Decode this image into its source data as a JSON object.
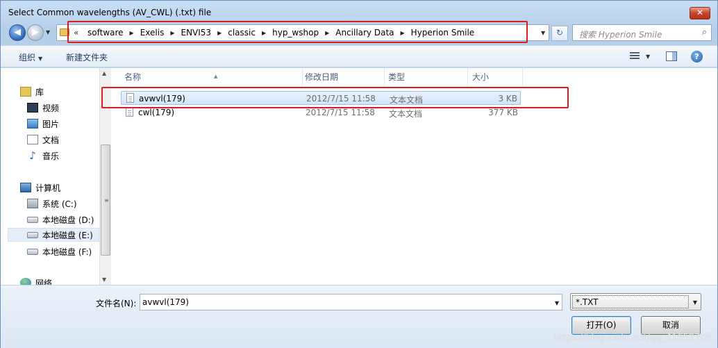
{
  "window": {
    "title": "Select Common wavelengths (AV_CWL) (.txt) file",
    "close_glyph": "✕"
  },
  "nav": {
    "back_glyph": "◀",
    "forward_glyph": "▶",
    "address": {
      "overflow_glyph": "«",
      "crumbs": [
        "software",
        "Exelis",
        "ENVI53",
        "classic",
        "hyp_wshop",
        "Ancillary Data",
        "Hyperion Smile"
      ],
      "separator_glyph": "▶"
    },
    "refresh_glyph": "↻",
    "search_placeholder": "搜索 Hyperion Smile"
  },
  "toolbar": {
    "organize": "组织",
    "new_folder": "新建文件夹"
  },
  "sidebar": {
    "items": [
      {
        "label": "库",
        "icon": "library-icon"
      },
      {
        "label": "视频",
        "icon": "video-icon"
      },
      {
        "label": "图片",
        "icon": "pictures-icon"
      },
      {
        "label": "文档",
        "icon": "documents-icon"
      },
      {
        "label": "音乐",
        "icon": "music-icon"
      },
      {
        "label": "计算机",
        "icon": "computer-icon"
      },
      {
        "label": "系统 (C:)",
        "icon": "system-drive-icon"
      },
      {
        "label": "本地磁盘 (D:)",
        "icon": "drive-icon"
      },
      {
        "label": "本地磁盘 (E:)",
        "icon": "drive-icon",
        "selected": true
      },
      {
        "label": "本地磁盘 (F:)",
        "icon": "drive-icon"
      },
      {
        "label": "网络",
        "icon": "network-icon"
      }
    ]
  },
  "files": {
    "columns": [
      "名称",
      "修改日期",
      "类型",
      "大小"
    ],
    "rows": [
      {
        "name": "avwvl(179)",
        "date": "2012/7/15 11:58",
        "type": "文本文档",
        "size": "3 KB",
        "selected": true
      },
      {
        "name": "cwl(179)",
        "date": "2012/7/15 11:58",
        "type": "文本文档",
        "size": "377 KB",
        "selected": false
      }
    ]
  },
  "bottom": {
    "filename_label": "文件名(N):",
    "filename_value": "avwvl(179)",
    "filter_value": "*.TXT",
    "open_button": "打开(O)",
    "cancel_button": "取消"
  },
  "watermark": "https://blog.csdn.net/qq_41652705",
  "colors": {
    "highlight_outline": "#e01b1b",
    "selection": "#d3e4f8"
  }
}
